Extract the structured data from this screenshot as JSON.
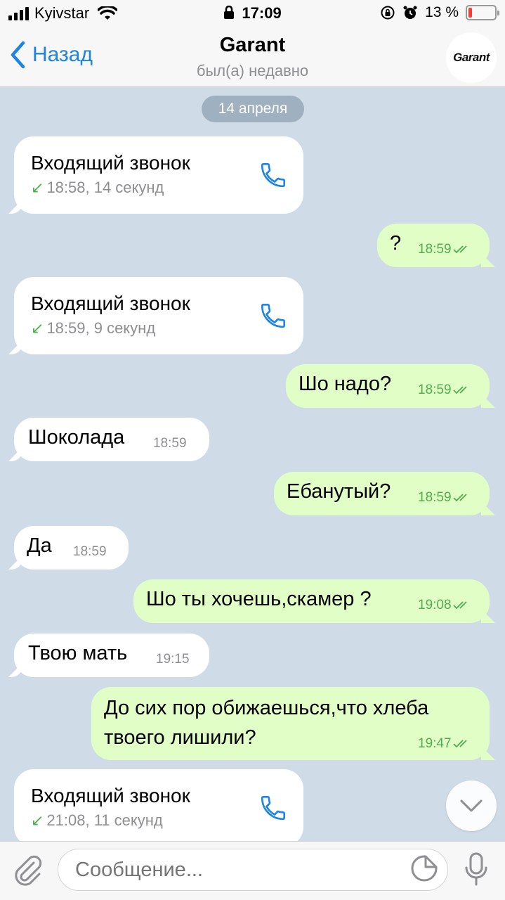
{
  "status_bar": {
    "carrier": "Kyivstar",
    "time": "17:09",
    "battery_text": "13 %",
    "battery_level": 0.13
  },
  "header": {
    "back_label": "Назад",
    "title": "Garant",
    "subtitle": "был(а) недавно",
    "avatar_text": "Garant"
  },
  "chat": {
    "date": "14 апреля",
    "calls": [
      {
        "title": "Входящий звонок",
        "meta": "18:58, 14 секунд"
      },
      {
        "title": "Входящий звонок",
        "meta": "18:59, 9 секунд"
      },
      {
        "title": "Входящий звонок",
        "meta": "21:08, 11 секунд"
      }
    ],
    "messages": [
      {
        "direction": "out",
        "text": "?",
        "time": "18:59"
      },
      {
        "direction": "out",
        "text": "Шо надо?",
        "time": "18:59"
      },
      {
        "direction": "in",
        "text": "Шоколада",
        "time": "18:59"
      },
      {
        "direction": "out",
        "text": "Ебанутый?",
        "time": "18:59"
      },
      {
        "direction": "in",
        "text": "Да",
        "time": "18:59"
      },
      {
        "direction": "out",
        "text": "Шо ты хочешь,скамер ?",
        "time": "19:08"
      },
      {
        "direction": "in",
        "text": "Твою мать",
        "time": "19:15"
      },
      {
        "direction": "out",
        "text_line1": "До сих пор обижаешься,что хлеба",
        "text_line2": "твоего лишили?",
        "time": "19:47"
      }
    ]
  },
  "input": {
    "placeholder": "Сообщение..."
  },
  "colors": {
    "accent": "#1d83e4",
    "incoming_bubble": "#ffffff",
    "outgoing_bubble": "#e1fec6",
    "read_check": "#4fae4e",
    "chat_background": "#cfdbe6"
  }
}
